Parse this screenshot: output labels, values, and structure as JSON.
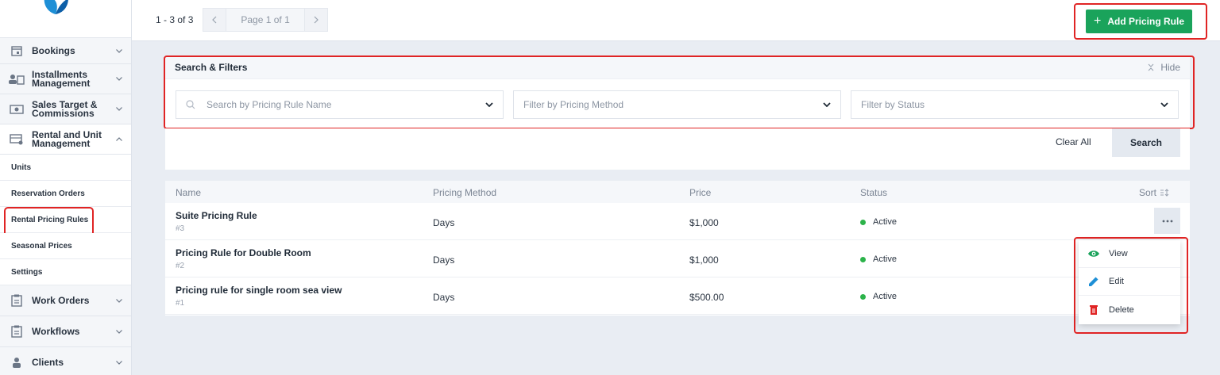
{
  "sidebar": {
    "items_top": [
      {
        "label": "Bookings",
        "icon": "calendar-icon"
      },
      {
        "label_line1": "Installments",
        "label_line2": "Management",
        "icon": "people-icon"
      },
      {
        "label_line1": "Sales Target &",
        "label_line2": "Commissions",
        "icon": "money-icon"
      },
      {
        "label_line1": "Rental and Unit",
        "label_line2": "Management",
        "icon": "rental-icon"
      }
    ],
    "sub_items": [
      "Units",
      "Reservation Orders",
      "Rental Pricing Rules",
      "Seasonal Prices",
      "Settings"
    ],
    "items_bottom": [
      {
        "label": "Work Orders",
        "icon": "clipboard-icon"
      },
      {
        "label": "Workflows",
        "icon": "clipboard-icon"
      },
      {
        "label": "Clients",
        "icon": "user-icon"
      }
    ]
  },
  "topbar": {
    "count": "1 - 3 of 3",
    "page_info": "Page 1 of 1",
    "add_label": "Add Pricing Rule"
  },
  "filters": {
    "title": "Search & Filters",
    "hide_label": "Hide",
    "search_placeholder": "Search by Pricing Rule Name",
    "method_placeholder": "Filter by Pricing Method",
    "status_placeholder": "Filter by Status",
    "clear_label": "Clear All",
    "search_label": "Search"
  },
  "table": {
    "headers": {
      "name": "Name",
      "method": "Pricing Method",
      "price": "Price",
      "status": "Status",
      "sort": "Sort"
    },
    "rows": [
      {
        "name": "Suite Pricing Rule",
        "id": "#3",
        "method": "Days",
        "price": "$1,000",
        "status": "Active"
      },
      {
        "name": "Pricing Rule for Double Room",
        "id": "#2",
        "method": "Days",
        "price": "$1,000",
        "status": "Active"
      },
      {
        "name": "Pricing rule for single room sea view",
        "id": "#1",
        "method": "Days",
        "price": "$500.00",
        "status": "Active"
      }
    ]
  },
  "menu": {
    "view": "View",
    "edit": "Edit",
    "delete": "Delete"
  },
  "colors": {
    "accent_green": "#1aa35b",
    "highlight_red": "#e02424",
    "status_active": "#2cb34a"
  }
}
